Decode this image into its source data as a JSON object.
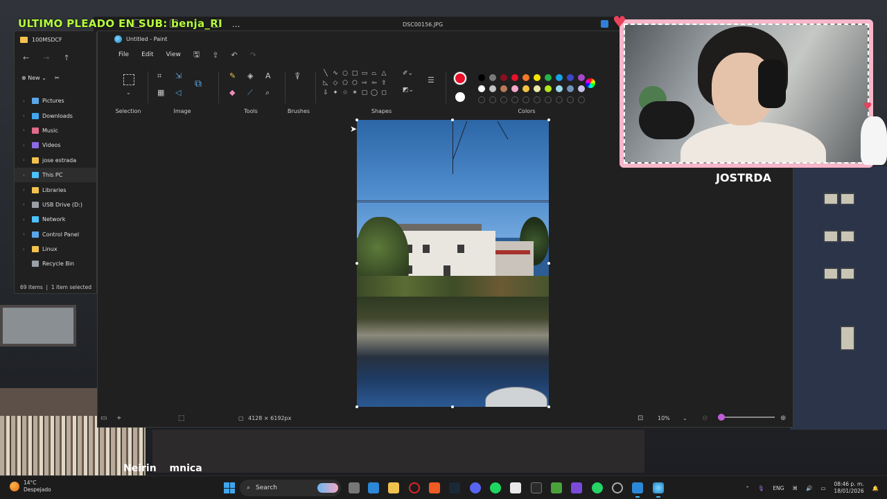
{
  "stream": {
    "banner": "ULTIMO PLEADO EN SUB: benja_RI",
    "name": "JOSTRDA",
    "caption": "Neirin mnica"
  },
  "viewer": {
    "filename": "DSC00156.JPG",
    "more_label": "..."
  },
  "explorer": {
    "title": "100MSDCF",
    "new_label": "New",
    "items": [
      {
        "label": "Pictures",
        "icon": "pictures-icon",
        "color": "#5aa6e8"
      },
      {
        "label": "Downloads",
        "icon": "downloads-icon",
        "color": "#3fa6ee"
      },
      {
        "label": "Music",
        "icon": "music-icon",
        "color": "#e06b8a"
      },
      {
        "label": "Videos",
        "icon": "videos-icon",
        "color": "#8b6ae6"
      },
      {
        "label": "jose estrada",
        "icon": "folder-icon",
        "color": "#f2c24f"
      },
      {
        "label": "This PC",
        "icon": "pc-icon",
        "color": "#4cc2ff"
      },
      {
        "label": "Libraries",
        "icon": "folder-icon",
        "color": "#f2c24f"
      },
      {
        "label": "USB Drive (D:)",
        "icon": "usb-icon",
        "color": "#9aa0a6"
      },
      {
        "label": "Network",
        "icon": "network-icon",
        "color": "#4cc2ff"
      },
      {
        "label": "Control Panel",
        "icon": "control-panel-icon",
        "color": "#5aa6e8"
      },
      {
        "label": "Linux",
        "icon": "linux-icon",
        "color": "#f2c24f"
      },
      {
        "label": "Recycle Bin",
        "icon": "recycle-bin-icon",
        "color": "#9aa0a6"
      }
    ],
    "status_items": "69 items",
    "status_selected": "1 item selected"
  },
  "paint": {
    "title": "Untitled - Paint",
    "menu": [
      "File",
      "Edit",
      "View"
    ],
    "groups": {
      "selection": "Selection",
      "image": "Image",
      "tools": "Tools",
      "brushes": "Brushes",
      "shapes": "Shapes",
      "colors": "Colors"
    },
    "color1": "#e8102a",
    "color2": "#ffffff",
    "palette": [
      "#000000",
      "#7a7a7a",
      "#8a1020",
      "#e8102a",
      "#f2782a",
      "#f5e500",
      "#28b34b",
      "#16a3e8",
      "#3a48cc",
      "#a24ac8",
      "#ffffff",
      "#c3c3c3",
      "#b97a57",
      "#f5a8c9",
      "#f5c542",
      "#eee8a8",
      "#b5e61d",
      "#99d9ea",
      "#7092be",
      "#c8bfe7"
    ],
    "canvas_size": "4128 × 6192px",
    "zoom": "10%"
  },
  "taskbar": {
    "temp": "14°C",
    "weather": "Despejado",
    "search_placeholder": "Search",
    "language": "ENG",
    "time": "08:46 p. m.",
    "date": "18/01/2026"
  }
}
